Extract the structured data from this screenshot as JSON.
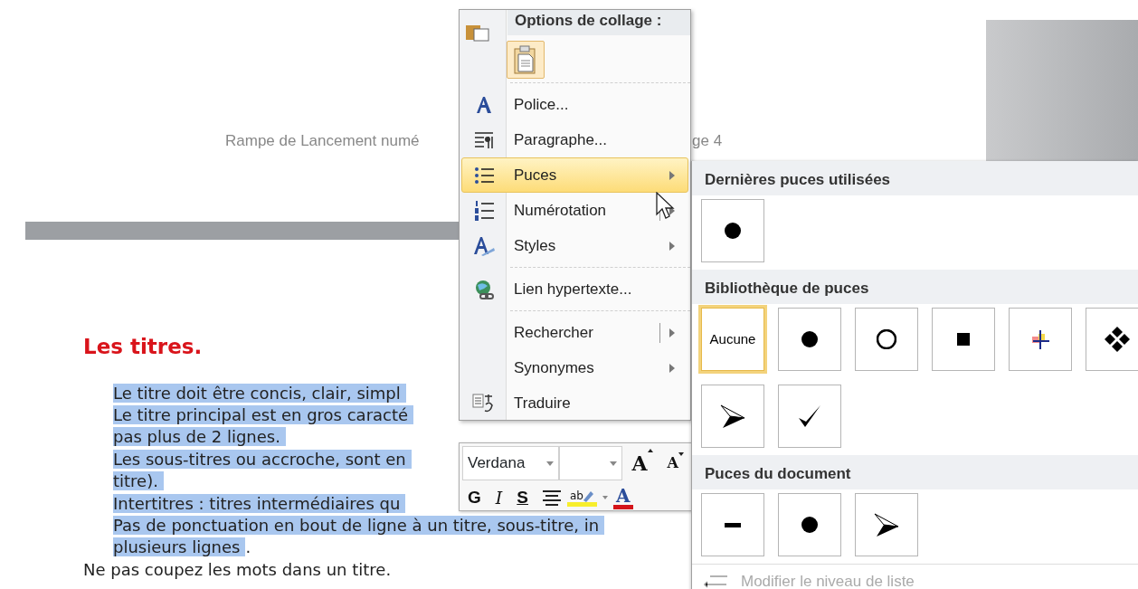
{
  "document": {
    "header_left": "Rampe de Lancement numé",
    "header_right": "ge 4",
    "heading": "Les titres.",
    "lines": [
      {
        "text": "Le titre doit être concis, clair, simpl",
        "selected": true,
        "indent": true
      },
      {
        "text": "Le titre principal est en gros caracté",
        "selected": true,
        "indent": true
      },
      {
        "text": "pas plus de 2 lignes.",
        "selected": true,
        "indent": true
      },
      {
        "text": "Les sous-titres ou accroche, sont en",
        "selected": true,
        "indent": true
      },
      {
        "text": "titre).",
        "selected": true,
        "indent": true
      },
      {
        "text": "Intertitres : titres intermédiaires qu",
        "selected": true,
        "indent": true
      },
      {
        "text": "Pas de ponctuation en bout de ligne à un titre, sous-titre, in",
        "selected": true,
        "indent": true
      },
      {
        "text": "plusieurs lignes",
        "selected": true,
        "indent": true,
        "tail": "."
      },
      {
        "text": "Ne pas coupez les mots dans un titre.",
        "selected": false,
        "indent": false
      }
    ]
  },
  "context_menu": {
    "header": "Options de collage :",
    "items": [
      {
        "label": "Police...",
        "kind": "font",
        "selected": false,
        "submenu": false,
        "split": false
      },
      {
        "label": "Paragraphe...",
        "kind": "paragraph",
        "selected": false,
        "submenu": false,
        "split": false
      },
      {
        "label": "Puces",
        "kind": "bullets",
        "selected": true,
        "submenu": true,
        "split": false
      },
      {
        "label": "Numérotation",
        "kind": "numbering",
        "selected": false,
        "submenu": true,
        "split": true
      },
      {
        "label": "Styles",
        "kind": "styles",
        "selected": false,
        "submenu": true,
        "split": false
      },
      {
        "label": "Lien hypertexte...",
        "kind": "link",
        "selected": false,
        "submenu": false,
        "split": false,
        "separator_before": true
      },
      {
        "label": "Rechercher",
        "kind": "none",
        "selected": false,
        "submenu": true,
        "split": true,
        "separator_before": true
      },
      {
        "label": "Synonymes",
        "kind": "none",
        "selected": false,
        "submenu": true,
        "split": false
      },
      {
        "label": "Traduire",
        "kind": "translate",
        "selected": false,
        "submenu": false,
        "split": false
      }
    ]
  },
  "mini_toolbar": {
    "font": "Verdana",
    "size_tools": [
      {
        "kind": "grow",
        "label": "A"
      },
      {
        "kind": "shrink",
        "label": "A"
      }
    ],
    "color_tools": [
      {
        "kind": "highlight",
        "label": "ab"
      },
      {
        "kind": "color",
        "label": "A"
      }
    ],
    "buttons": [
      {
        "label": "G",
        "kind": "bold"
      },
      {
        "label": "I",
        "kind": "italic"
      },
      {
        "label": "S",
        "kind": "strike"
      }
    ]
  },
  "bullet_menu": {
    "sections": [
      {
        "title": "Dernières puces utilisées",
        "tiles": [
          {
            "kind": "dot",
            "selected": false
          }
        ]
      },
      {
        "title": "Bibliothèque de puces",
        "tiles": [
          {
            "kind": "text",
            "label": "Aucune",
            "selected": true
          },
          {
            "kind": "dot",
            "selected": false
          },
          {
            "kind": "circle",
            "selected": false
          },
          {
            "kind": "square",
            "selected": false
          },
          {
            "kind": "cross",
            "selected": false
          },
          {
            "kind": "diamonds",
            "selected": false
          },
          {
            "kind": "arrow",
            "selected": false
          },
          {
            "kind": "check",
            "selected": false
          }
        ]
      },
      {
        "title": "Puces du document",
        "tiles": [
          {
            "kind": "dash",
            "selected": false
          },
          {
            "kind": "dot",
            "selected": false
          },
          {
            "kind": "arrow",
            "selected": false
          }
        ]
      }
    ],
    "footer": {
      "label": "Modifier le niveau de liste",
      "disabled": true
    }
  }
}
